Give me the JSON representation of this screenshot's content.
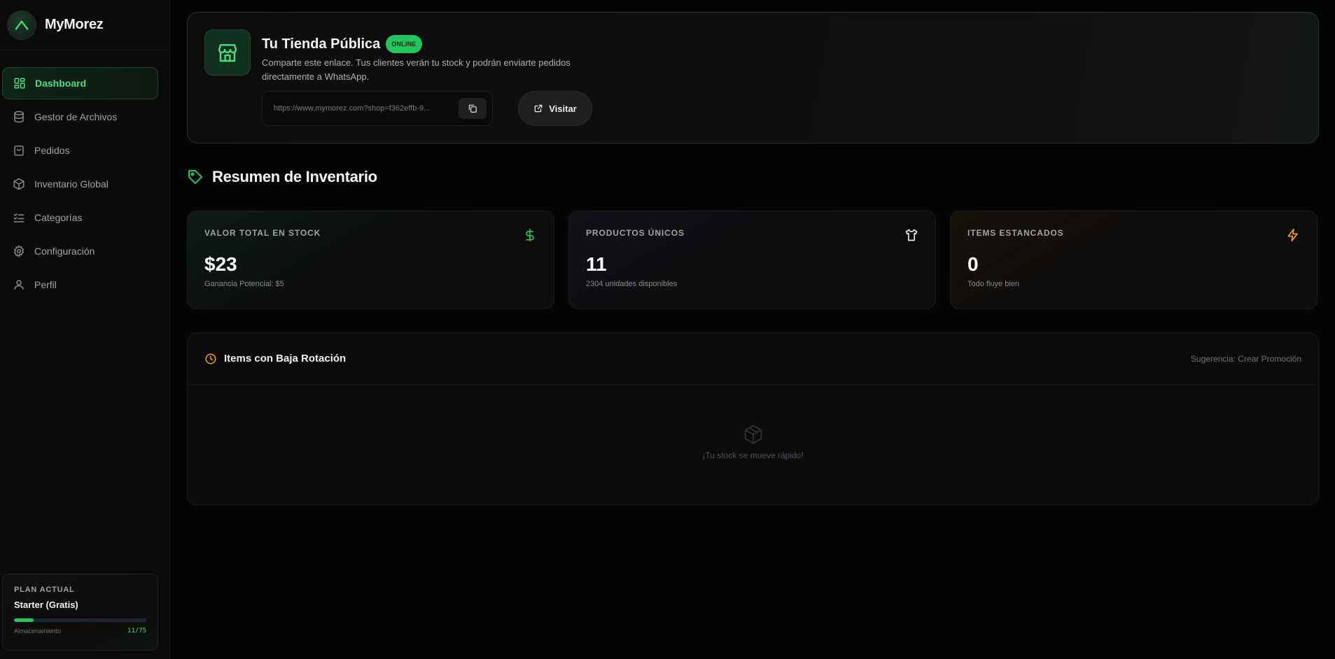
{
  "brand": {
    "name": "MyMorez"
  },
  "sidebar": {
    "items": [
      {
        "label": "Dashboard",
        "icon": "dashboard-icon",
        "active": true
      },
      {
        "label": "Gestor de Archivos",
        "icon": "database-icon"
      },
      {
        "label": "Pedidos",
        "icon": "shopping-bag-icon"
      },
      {
        "label": "Inventario Global",
        "icon": "box-icon"
      },
      {
        "label": "Categorías",
        "icon": "list-check-icon"
      },
      {
        "label": "Configuración",
        "icon": "gear-icon"
      },
      {
        "label": "Perfil",
        "icon": "user-icon"
      }
    ]
  },
  "plan": {
    "label": "PLAN ACTUAL",
    "name": "Starter (Gratis)",
    "storage_label": "Almacenamiento",
    "storage_value": "11/75",
    "storage_fraction": 0.1467
  },
  "store": {
    "title": "Tu Tienda Pública",
    "badge": "ONLINE",
    "description": "Comparte este enlace. Tus clientes verán tu stock y podrán enviarte pedidos directamente a WhatsApp.",
    "url": "https://www.mymorez.com?shop=f362effb-9...",
    "visit_label": "Visitar"
  },
  "summary": {
    "title": "Resumen de Inventario",
    "stats": [
      {
        "label": "VALOR TOTAL EN STOCK",
        "value": "$23",
        "sub": "Ganancia Potencial: $5",
        "icon": "dollar-icon",
        "color": "#22c55e"
      },
      {
        "label": "PRODUCTOS ÚNICOS",
        "value": "11",
        "sub": "2304 unidades disponibles",
        "icon": "shirt-icon",
        "color": "#e5e5e5"
      },
      {
        "label": "ITEMS ESTANCADOS",
        "value": "0",
        "sub": "Todo fluye bien",
        "icon": "lightning-icon",
        "color": "#f59e0b"
      }
    ]
  },
  "rotation": {
    "title": "Items con Baja Rotación",
    "hint": "Sugerencia: Crear Promoción",
    "empty": "¡Tu stock se mueve rápido!"
  },
  "colors": {
    "accent": "#22c55e",
    "warning": "#f59e0b"
  }
}
